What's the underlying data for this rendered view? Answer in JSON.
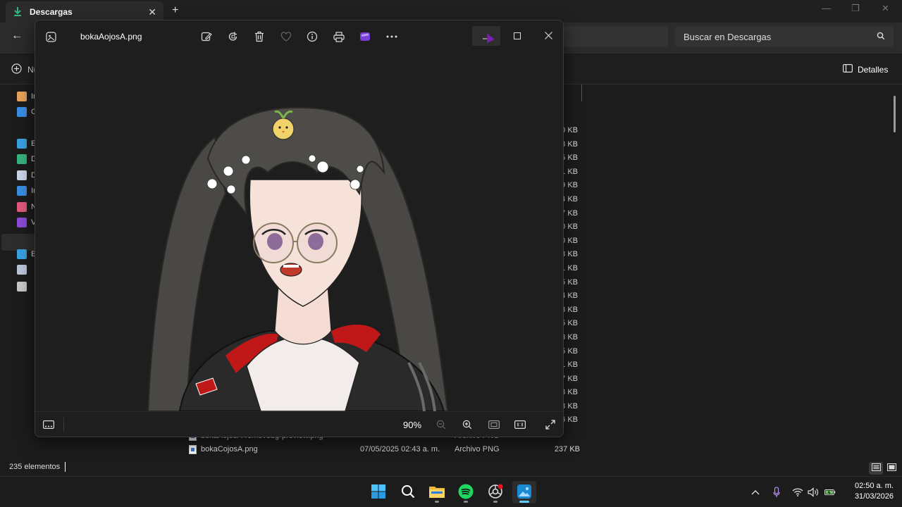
{
  "explorer": {
    "tab_title": "Descargas",
    "search_placeholder": "Buscar en Descargas",
    "new_label": "Nu",
    "details_label": "Detalles",
    "sidebar": [
      {
        "label": "In",
        "icon": "home-icon",
        "color": "#e8a35a"
      },
      {
        "label": "C",
        "icon": "onedrive-icon",
        "color": "#3b8ee6"
      },
      {
        "label": "E",
        "icon": "desktop-icon",
        "color": "#3aa0e0"
      },
      {
        "label": "D",
        "icon": "download-icon",
        "color": "#36b37e"
      },
      {
        "label": "D",
        "icon": "document-icon",
        "color": "#c9d6e8"
      },
      {
        "label": "Ir",
        "icon": "pictures-icon",
        "color": "#3a8de0"
      },
      {
        "label": "N",
        "icon": "music-icon",
        "color": "#e0587a"
      },
      {
        "label": "V",
        "icon": "videos-icon",
        "color": "#8a4bd6"
      },
      {
        "label": "E",
        "icon": "this-pc-icon",
        "color": "#3aa0e0"
      },
      {
        "label": "",
        "icon": "network-drive-icon",
        "color": "#b8c6d8"
      },
      {
        "label": "",
        "icon": "drive-icon",
        "color": "#c8c8c8"
      }
    ],
    "sizes": [
      "0 KB",
      "3 KB",
      "5 KB",
      "1 KB",
      "9 KB",
      "4 KB",
      "7 KB",
      "0 KB",
      "0 KB",
      "3 KB",
      "1 KB",
      "5 KB",
      "4 KB",
      "3 KB",
      "5 KB",
      "3 KB",
      "5 KB",
      "1 KB",
      "7 KB",
      "3 KB",
      "3 KB",
      "56 KB"
    ],
    "visible_file": {
      "name": "bokaCojosA.png",
      "date": "07/05/2025 02:43 a. m.",
      "type": "Archivo PNG",
      "size": "237 KB"
    },
    "partial_row": {
      "name": "bokaAojosA-removebg-preview.png",
      "type": "Archivo PNG"
    },
    "status_count": "235 elementos"
  },
  "photos": {
    "filename": "bokaAojosA.png",
    "zoom": "90%",
    "accent": "#7a3fd6"
  },
  "taskbar": {
    "clock_time": "02:50 a. m.",
    "clock_date": "31/03/2026"
  }
}
